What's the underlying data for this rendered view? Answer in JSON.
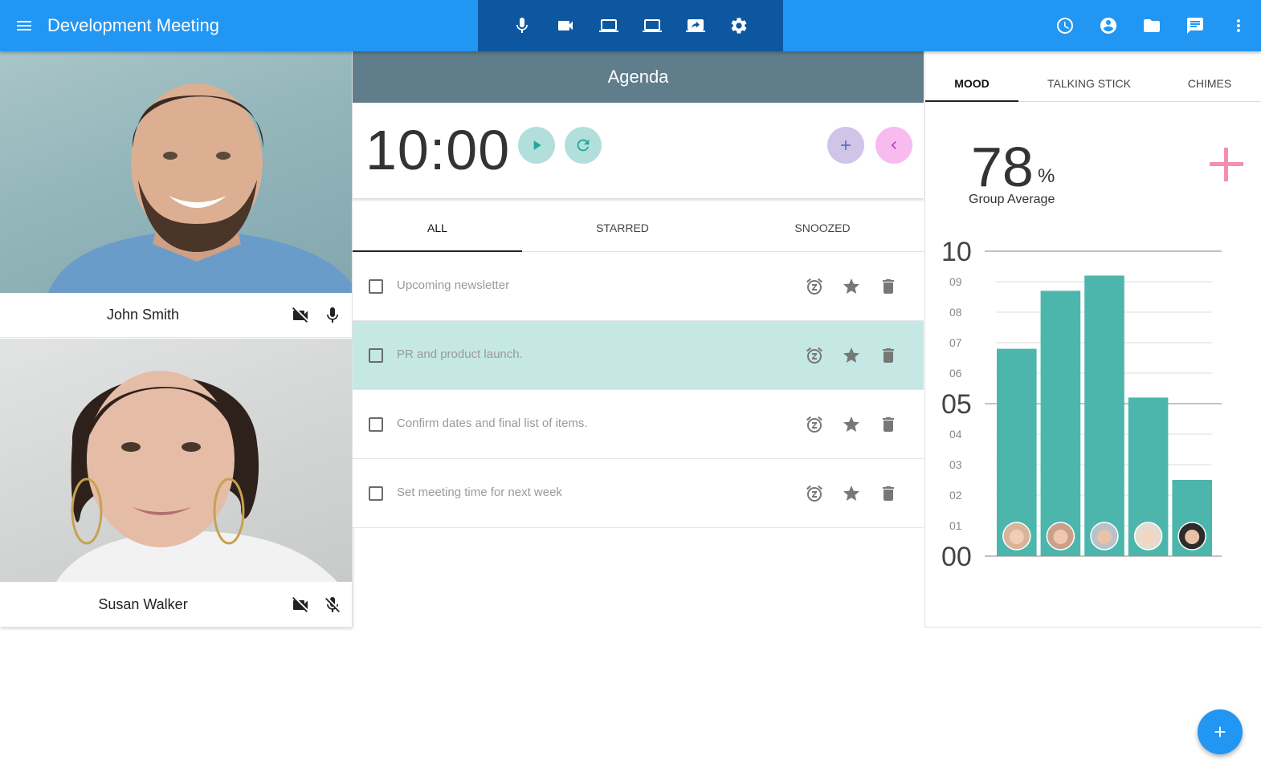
{
  "app": {
    "title": "Development Meeting"
  },
  "topbar": {
    "menu_icon": "menu-icon",
    "call_controls": [
      "mic-icon",
      "videocam-icon",
      "laptop-icon",
      "laptop-icon",
      "screen-share-icon",
      "settings-icon"
    ],
    "right_actions": [
      "history-icon",
      "account-circle-icon",
      "folder-icon",
      "chat-icon",
      "more-vert-icon"
    ]
  },
  "participants": [
    {
      "name": "John Smith",
      "video": "off",
      "mic": "on"
    },
    {
      "name": "Susan Walker",
      "video": "off",
      "mic": "off"
    }
  ],
  "agenda": {
    "title": "Agenda",
    "timer": "10:00",
    "tabs": [
      "ALL",
      "STARRED",
      "SNOOZED"
    ],
    "active_tab": "ALL",
    "items": [
      {
        "text": "Upcoming newsletter",
        "checked": false,
        "highlighted": false
      },
      {
        "text": "PR and product launch.",
        "checked": false,
        "highlighted": true
      },
      {
        "text": "Confirm dates and final list of items.",
        "checked": false,
        "highlighted": false
      },
      {
        "text": "Set meeting time for next week",
        "checked": false,
        "highlighted": false
      }
    ]
  },
  "mood": {
    "tabs": [
      "MOOD",
      "TALKING STICK",
      "CHIMES"
    ],
    "active_tab": "MOOD",
    "group_average_value": "78",
    "group_average_unit": "%",
    "group_average_label": "Group Average"
  },
  "chart_data": {
    "type": "bar",
    "categories": [
      "participant-1",
      "participant-2",
      "participant-3",
      "participant-4",
      "participant-5"
    ],
    "values": [
      6.8,
      8.7,
      9.2,
      5.2,
      2.5
    ],
    "ylim": [
      0,
      10
    ],
    "yticks": [
      "00",
      "01",
      "02",
      "03",
      "04",
      "05",
      "06",
      "07",
      "08",
      "09",
      "10"
    ],
    "major_ticks": [
      "00",
      "05",
      "10"
    ],
    "bar_color": "#4DB6AC",
    "grid": true
  },
  "colors": {
    "primary": "#2196F3",
    "primary_dark": "#0D57A0",
    "agenda_header": "#607D8B",
    "highlight_row": "#C5E8E4",
    "bar": "#4DB6AC",
    "add_mood": "#F48FB1"
  }
}
